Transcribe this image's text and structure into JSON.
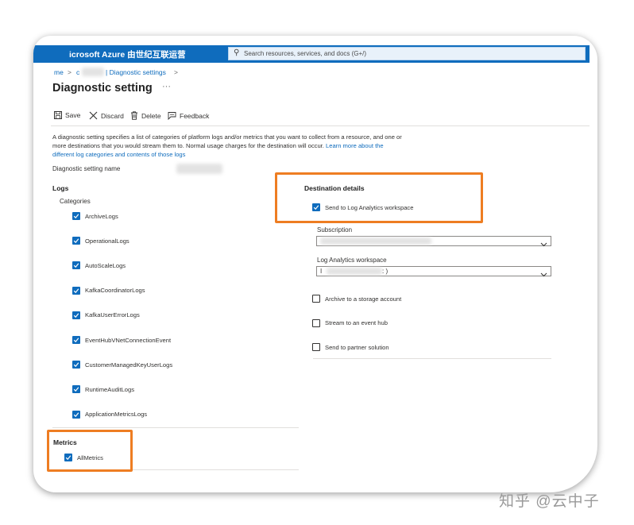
{
  "app": {
    "brand": "icrosoft Azure 由世纪互联运营",
    "search_placeholder": "Search resources, services, and docs (G+/)"
  },
  "breadcrumb": {
    "home": "me",
    "sep": ">",
    "resource": "c",
    "resource_tail": "",
    "current": "| Diagnostic settings"
  },
  "page": {
    "title": "Diagnostic setting",
    "more": "···"
  },
  "toolbar": {
    "save": "Save",
    "discard": "Discard",
    "delete": "Delete",
    "feedback": "Feedback"
  },
  "description": {
    "text": "A diagnostic setting specifies a list of categories of platform logs and/or metrics that you want to collect from a resource, and one or more destinations that you would stream them to. Normal usage charges for the destination will occur.",
    "link": "Learn more about the different log categories and contents of those logs"
  },
  "setting_name_label": "Diagnostic setting name",
  "logs": {
    "heading": "Logs",
    "categories_label": "Categories",
    "items": [
      {
        "label": "ArchiveLogs",
        "checked": true
      },
      {
        "label": "OperationalLogs",
        "checked": true
      },
      {
        "label": "AutoScaleLogs",
        "checked": true
      },
      {
        "label": "KafkaCoordinatorLogs",
        "checked": true
      },
      {
        "label": "KafkaUserErrorLogs",
        "checked": true
      },
      {
        "label": "EventHubVNetConnectionEvent",
        "checked": true
      },
      {
        "label": "CustomerManagedKeyUserLogs",
        "checked": true
      },
      {
        "label": "RuntimeAuditLogs",
        "checked": true
      },
      {
        "label": "ApplicationMetricsLogs",
        "checked": true
      }
    ]
  },
  "metrics": {
    "heading": "Metrics",
    "items": [
      {
        "label": "AllMetrics",
        "checked": true
      }
    ]
  },
  "destination": {
    "heading": "Destination details",
    "send_to_la": {
      "label": "Send to Log Analytics workspace",
      "checked": true
    },
    "subscription_label": "Subscription",
    "subscription_value": "",
    "workspace_label": "Log Analytics workspace",
    "workspace_value_start": "I",
    "workspace_value_end": ": )",
    "options": [
      {
        "label": "Archive to a storage account",
        "checked": false
      },
      {
        "label": "Stream to an event hub",
        "checked": false
      },
      {
        "label": "Send to partner solution",
        "checked": false
      }
    ]
  },
  "watermark": "知乎 @云中子",
  "colors": {
    "accent": "#0f6cbd",
    "highlight": "#ee7d22"
  }
}
